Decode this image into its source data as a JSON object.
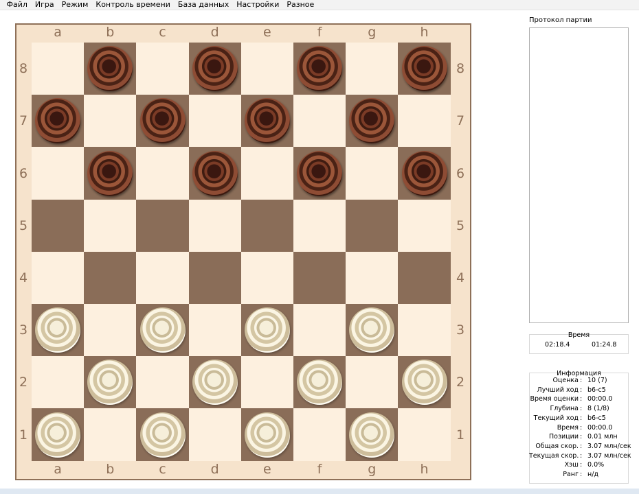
{
  "menu": {
    "items": [
      "Файл",
      "Игра",
      "Режим",
      "Контроль времени",
      "База данных",
      "Настройки",
      "Разное"
    ]
  },
  "board": {
    "files": [
      "a",
      "b",
      "c",
      "d",
      "e",
      "f",
      "g",
      "h"
    ],
    "ranks": [
      "8",
      "7",
      "6",
      "5",
      "4",
      "3",
      "2",
      "1"
    ],
    "dark_pieces": [
      "b8",
      "d8",
      "f8",
      "h8",
      "a7",
      "c7",
      "e7",
      "g7",
      "b6",
      "d6",
      "f6",
      "h6"
    ],
    "light_pieces": [
      "a3",
      "c3",
      "e3",
      "g3",
      "b2",
      "d2",
      "f2",
      "h2",
      "a1",
      "c1",
      "e1",
      "g1"
    ],
    "colors": {
      "light_square": "#fdf0df",
      "dark_square": "#8a6d58",
      "frame": "#f6e3cc"
    }
  },
  "protocol": {
    "label": "Протокол партии"
  },
  "time": {
    "title": "Время",
    "white": "02:18.4",
    "black": "01:24.8"
  },
  "info": {
    "title": "Информация",
    "rows": [
      {
        "label": "Оценка",
        "value": "10 (7)"
      },
      {
        "label": "Лучший ход",
        "value": "b6-c5"
      },
      {
        "label": "Время оценки",
        "value": "00:00.0"
      },
      {
        "label": "Глубина",
        "value": "8 (1/8)"
      },
      {
        "label": "Текущий ход",
        "value": "b6-c5"
      },
      {
        "label": "Время",
        "value": "00:00.0"
      },
      {
        "label": "Позиции",
        "value": "0.01 млн"
      },
      {
        "label": "Общая скор.",
        "value": "3.07 млн/сек"
      },
      {
        "label": "Текущая скор.",
        "value": "3.07 млн/сек"
      },
      {
        "label": "Хэш",
        "value": "0.0%"
      },
      {
        "label": "Ранг",
        "value": "н/д"
      }
    ]
  }
}
